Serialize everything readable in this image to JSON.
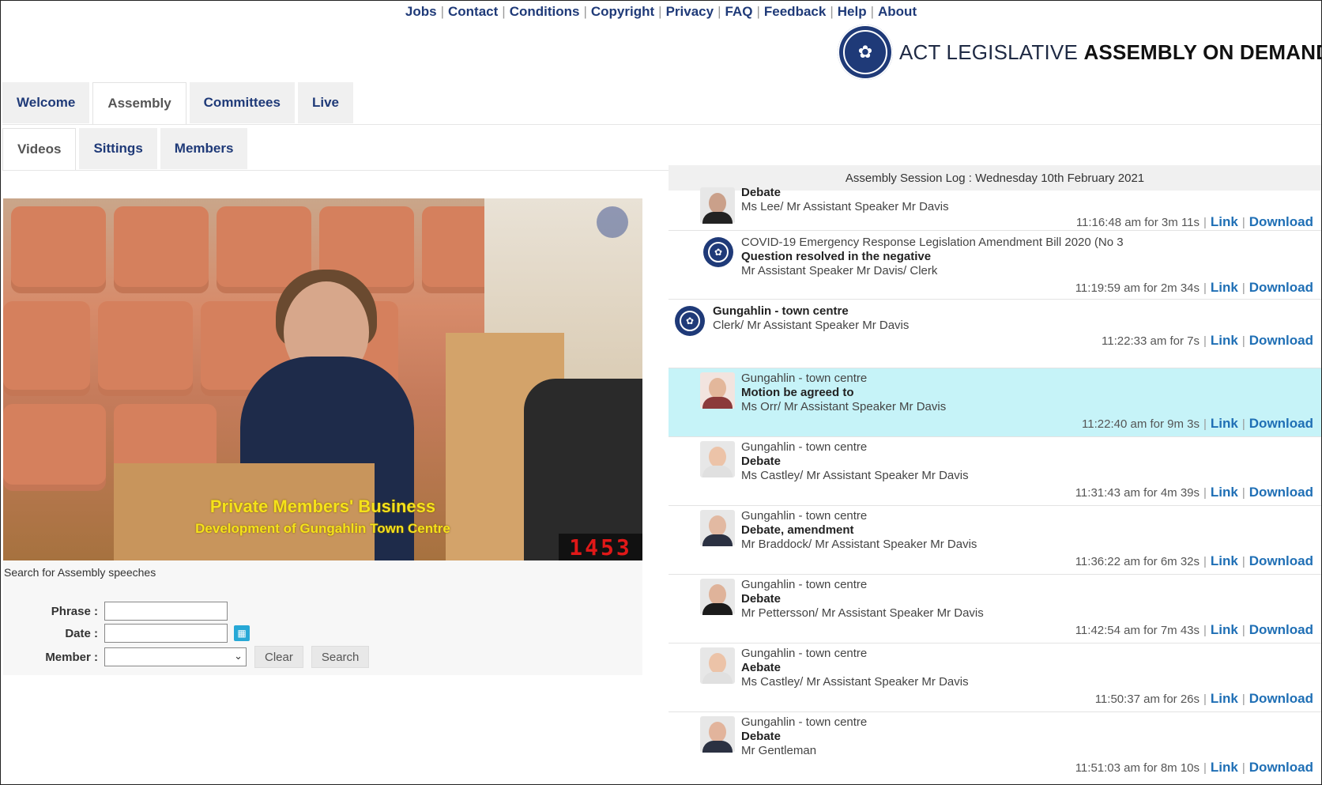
{
  "top_links": [
    "Jobs",
    "Contact",
    "Conditions",
    "Copyright",
    "Privacy",
    "FAQ",
    "Feedback",
    "Help",
    "About"
  ],
  "brand": {
    "light": "ACT LEGISLATIVE ",
    "bold": "ASSEMBLY ON DEMAND",
    "logo_icon": "assembly-seal-icon"
  },
  "tabs_primary": [
    {
      "label": "Welcome",
      "active": false
    },
    {
      "label": "Assembly",
      "active": true
    },
    {
      "label": "Committees",
      "active": false
    },
    {
      "label": "Live",
      "active": false
    }
  ],
  "tabs_secondary": [
    {
      "label": "Videos",
      "active": true
    },
    {
      "label": "Sittings",
      "active": false
    },
    {
      "label": "Members",
      "active": false
    }
  ],
  "video": {
    "caption_title": "Private Members' Business",
    "caption_subtitle": "Development of Gungahlin Town Centre",
    "clock": "1453"
  },
  "search": {
    "title": "Search for Assembly speeches",
    "phrase_label": "Phrase :",
    "date_label": "Date :",
    "member_label": "Member :",
    "phrase_value": "",
    "date_value": "",
    "member_value": "",
    "clear_label": "Clear",
    "search_label": "Search"
  },
  "log": {
    "header": "Assembly Session Log : Wednesday 10th February 2021",
    "link_label": "Link",
    "download_label": "Download",
    "entries": [
      {
        "line1": "Debate",
        "line2": "Ms Lee/ Mr Assistant Speaker Mr Davis",
        "line3": "",
        "meta": "11:16:48 am for 3m 11s",
        "thumb": "portrait",
        "highlight": false
      },
      {
        "line1": "COVID-19 Emergency Response Legislation Amendment Bill 2020 (No 3",
        "line2": "Question resolved in the negative",
        "line3": "Mr Assistant Speaker Mr Davis/ Clerk",
        "meta": "11:19:59 am for 2m 34s",
        "thumb": "logo",
        "highlight": false
      },
      {
        "line1": "Gungahlin - town centre",
        "line2": "Clerk/ Mr Assistant Speaker Mr Davis",
        "line3": "",
        "meta": "11:22:33 am for 7s",
        "thumb": "logo",
        "highlight": false
      },
      {
        "line1": "Gungahlin - town centre",
        "line2": "Motion be agreed to",
        "line3": "Ms Orr/ Mr Assistant Speaker Mr Davis",
        "meta": "11:22:40 am for 9m 3s",
        "thumb": "portrait",
        "highlight": true
      },
      {
        "line1": "Gungahlin - town centre",
        "line2": "Debate",
        "line3": "Ms Castley/ Mr Assistant Speaker Mr Davis",
        "meta": "11:31:43 am for 4m 39s",
        "thumb": "portrait",
        "highlight": false
      },
      {
        "line1": "Gungahlin - town centre",
        "line2": "Debate, amendment",
        "line3": "Mr Braddock/ Mr Assistant Speaker Mr Davis",
        "meta": "11:36:22 am for 6m 32s",
        "thumb": "portrait",
        "highlight": false
      },
      {
        "line1": "Gungahlin - town centre",
        "line2": "Debate",
        "line3": "Mr Pettersson/ Mr Assistant Speaker Mr Davis",
        "meta": "11:42:54 am for 7m 43s",
        "thumb": "portrait",
        "highlight": false
      },
      {
        "line1": "Gungahlin - town centre",
        "line2": "Aebate",
        "line3": "Ms Castley/ Mr Assistant Speaker Mr Davis",
        "meta": "11:50:37 am for 26s",
        "thumb": "portrait",
        "highlight": false
      },
      {
        "line1": "Gungahlin - town centre",
        "line2": "Debate",
        "line3": "Mr Gentleman",
        "meta": "11:51:03 am for 8m 10s",
        "thumb": "portrait",
        "highlight": false
      }
    ]
  }
}
